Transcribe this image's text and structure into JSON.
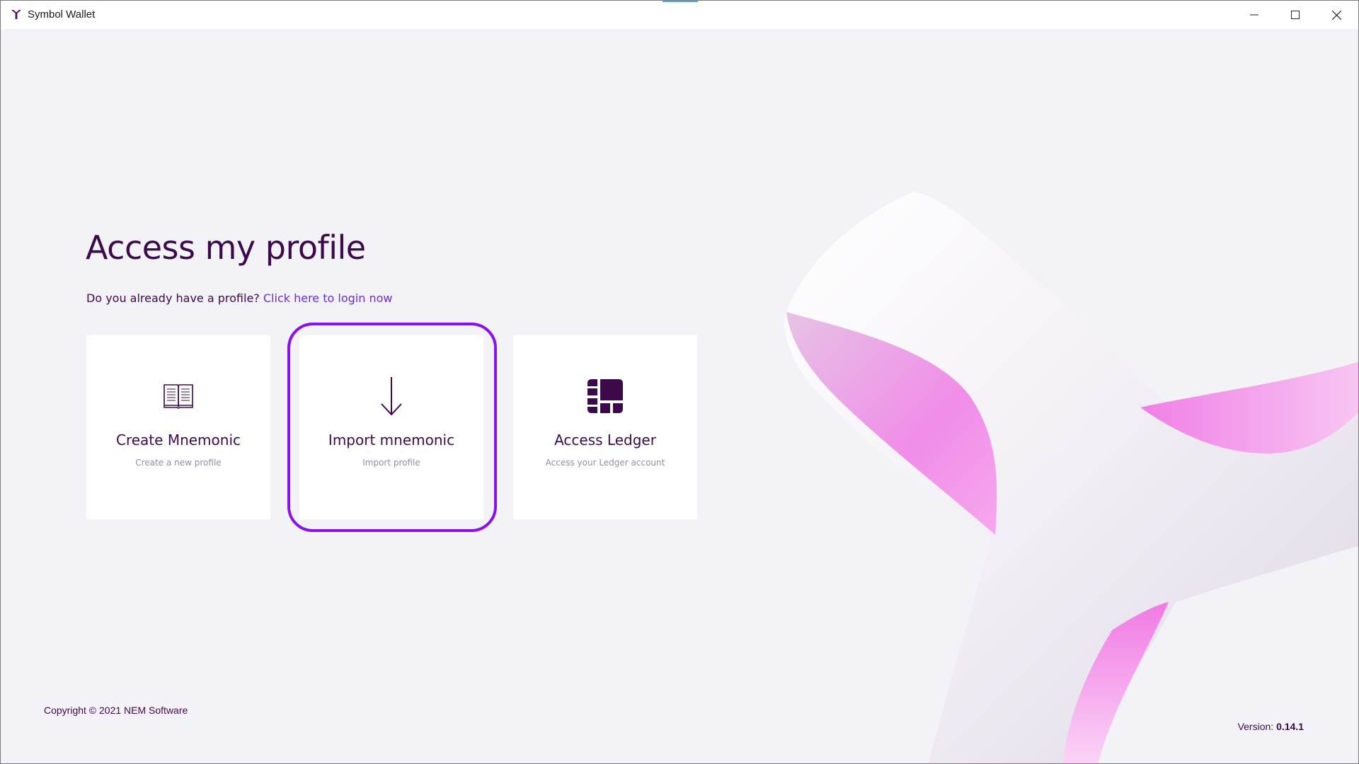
{
  "window": {
    "title": "Symbol Wallet",
    "icon": "symbol-logo-icon",
    "controls": [
      "minimize-icon",
      "maximize-icon",
      "close-icon"
    ]
  },
  "page": {
    "title": "Access my profile",
    "login_prompt": "Do you already have a profile?",
    "login_link": "Click here to login now"
  },
  "cards": [
    {
      "title": "Create Mnemonic",
      "subtitle": "Create a new profile",
      "icon": "book-icon"
    },
    {
      "title": "Import mnemonic",
      "subtitle": "Import profile",
      "icon": "arrow-down-icon"
    },
    {
      "title": "Access Ledger",
      "subtitle": "Access your Ledger account",
      "icon": "ledger-icon"
    }
  ],
  "footer": {
    "copyright": "Copyright © 2021 NEM Software",
    "version_label": "Version:",
    "version_value": "0.14.1"
  },
  "colors": {
    "primary_text": "#3c0a4b",
    "link": "#6b2fd6",
    "highlight": "#8a10ee",
    "background": "#f3f2f6",
    "card": "#ffffff"
  }
}
